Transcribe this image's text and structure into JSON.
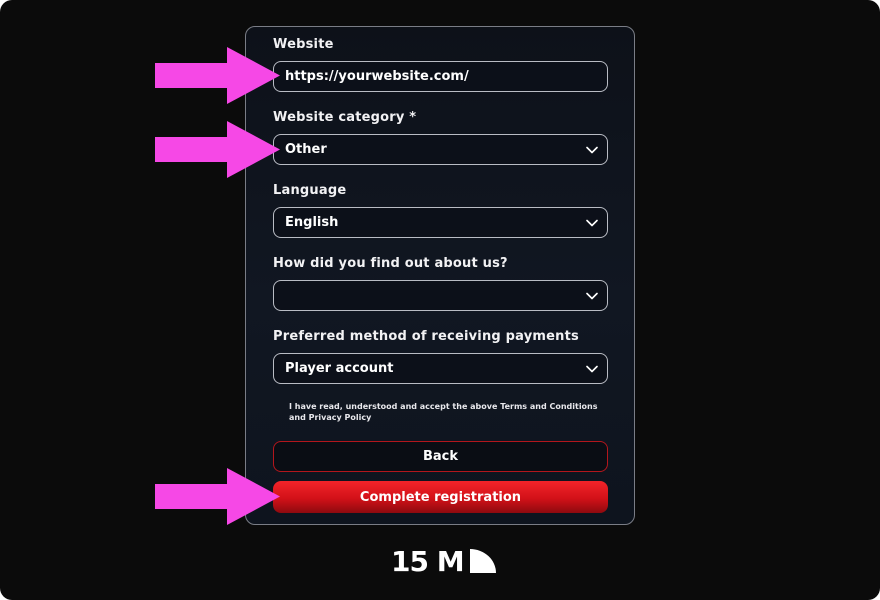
{
  "form": {
    "website_label": "Website",
    "website_value": "https://yourwebsite.com/",
    "category_label": "Website category *",
    "category_value": "Other",
    "language_label": "Language",
    "language_value": "English",
    "source_label": "How did you find out about us?",
    "source_value": "",
    "payment_label": "Preferred method of receiving payments",
    "payment_value": "Player account",
    "terms_text": "I have read, understood and accept the above Terms and Conditions and Privacy Policy",
    "back_label": "Back",
    "complete_label": "Complete registration"
  },
  "logo": {
    "text": "15 M"
  },
  "colors": {
    "background": "#0b0b0b",
    "panel": "#111722",
    "accent_red": "#e01a20",
    "arrow_pink": "#f648e6",
    "field_border": "#b9bcc4"
  },
  "icons": {
    "dropdown": "chevron-down-icon",
    "annotation": "arrow-right-icon",
    "brand": "logo-quarter-circle-icon"
  }
}
